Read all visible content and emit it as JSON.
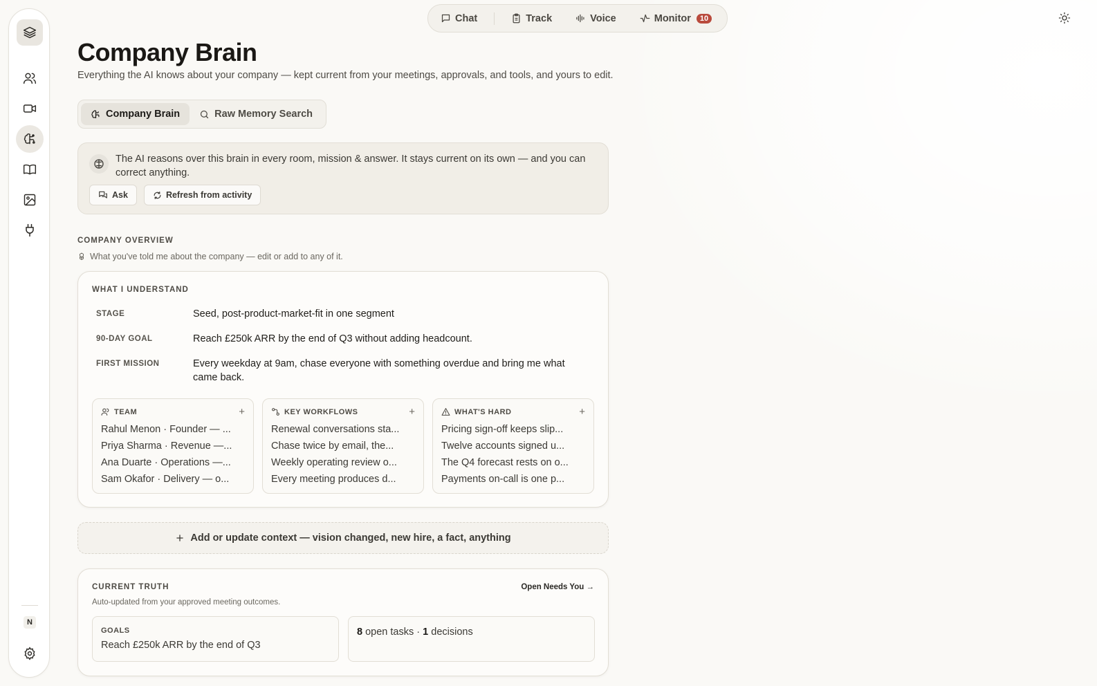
{
  "nav": {
    "items": [
      {
        "label": "Chat",
        "icon": "chat-bubble-icon"
      },
      {
        "label": "Track",
        "icon": "clipboard-icon"
      },
      {
        "label": "Voice",
        "icon": "waveform-icon"
      },
      {
        "label": "Monitor",
        "icon": "activity-icon",
        "badge": "10"
      }
    ],
    "theme_icon": "sun-icon"
  },
  "sidebar": {
    "items": [
      {
        "icon": "layers-icon",
        "active": false
      },
      {
        "icon": "users-icon",
        "active": false
      },
      {
        "icon": "video-icon",
        "active": false
      },
      {
        "icon": "brain-icon",
        "active": true
      },
      {
        "icon": "book-icon",
        "active": false
      },
      {
        "icon": "image-icon",
        "active": false
      },
      {
        "icon": "plug-icon",
        "active": false
      }
    ],
    "user_initial": "N",
    "settings_icon": "gear-icon"
  },
  "header": {
    "title": "Company Brain",
    "subtitle": "Everything the AI knows about your company — kept current from your meetings, approvals, and tools, and yours to edit."
  },
  "tabs": [
    {
      "label": "Company Brain",
      "icon": "brain-icon",
      "active": true
    },
    {
      "label": "Raw Memory Search",
      "icon": "search-icon",
      "active": false
    }
  ],
  "info": {
    "text": "The AI reasons over this brain in every room, mission & answer. It stays current on its own — and you can correct anything.",
    "ask_label": "Ask",
    "refresh_label": "Refresh from activity"
  },
  "overview": {
    "label": "COMPANY OVERVIEW",
    "sub": "What you've told me about the company — edit or add to any of it.",
    "card_label": "WHAT I UNDERSTAND",
    "fields": [
      {
        "key": "STAGE",
        "value": "Seed, post-product-market-fit in one segment"
      },
      {
        "key": "90-DAY GOAL",
        "value": "Reach £250k ARR by the end of Q3 without adding headcount."
      },
      {
        "key": "FIRST MISSION",
        "value": "Every weekday at 9am, chase everyone with something overdue and bring me what came back."
      }
    ],
    "groups": [
      {
        "title": "TEAM",
        "icon": "users-icon",
        "items": [
          "Rahul Menon · Founder — ...",
          "Priya Sharma · Revenue —...",
          "Ana Duarte · Operations —...",
          "Sam Okafor · Delivery — o..."
        ]
      },
      {
        "title": "KEY WORKFLOWS",
        "icon": "workflow-icon",
        "items": [
          "Renewal conversations sta...",
          "Chase twice by email, the...",
          "Weekly operating review o...",
          "Every meeting produces d..."
        ]
      },
      {
        "title": "WHAT'S HARD",
        "icon": "warning-icon",
        "items": [
          "Pricing sign-off keeps slip...",
          "Twelve accounts signed u...",
          "The Q4 forecast rests on o...",
          "Payments on-call is one p..."
        ]
      }
    ]
  },
  "add_context": {
    "label": "Add or update context — vision changed, new hire, a fact, anything"
  },
  "truth": {
    "label": "CURRENT TRUTH",
    "link": "Open Needs You →",
    "sub": "Auto-updated from your approved meeting outcomes.",
    "goals_label": "GOALS",
    "goals_value": "Reach £250k ARR by the end of Q3",
    "open_tasks": "8",
    "open_tasks_label": "open tasks ·",
    "decisions": "1",
    "decisions_label": "decisions"
  }
}
